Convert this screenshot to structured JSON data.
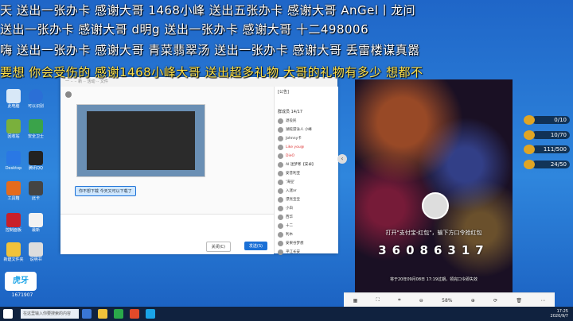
{
  "danmaku": {
    "line1": "天  送出一张办卡    感谢大哥   1468小峰  送出五张办卡      感谢大哥    AnGel丨龙问",
    "line2": "  送出一张办卡    感谢大哥    d明g        送出一张办卡      感谢大哥    十二498006",
    "line3": "嗨  送出一张办卡  感谢大哥   青菜翡翠汤 送出一张办卡    感谢大哥    丢雷楼谋真嚣",
    "line4": "要想 你会受伤的          感谢1468小峰大哥 送出超多礼物  大哥的礼物有多少 想都不"
  },
  "desktop_icons": [
    "此电脑",
    "可以识别",
    "回收站",
    "安全卫士",
    "Desktop",
    "腾讯QQ",
    "工具箱",
    "此卡",
    "控制面板",
    "最新",
    "新建文件夹",
    "说明书"
  ],
  "chat": {
    "header": "一 ·· ·· 新 ·· 活动 ·· 文件",
    "bubble": "你不想下载 今天又可以下载了",
    "send_label": "发送(S)",
    "close_label": "关闭(C)",
    "announce": "[公告]",
    "members_title": "群成员 14/17",
    "members": [
      "退役民",
      "湖蛇游泳人 小峰",
      "Johnny卡",
      "Like you@",
      "DieO",
      "AI 迷梦寒【安卓】",
      "安普利亚",
      "'海豆'",
      "入迷ar",
      "漂亮宝宝",
      "小白",
      "西华",
      "十二",
      "利木",
      "安果谷梦想",
      "平江长安"
    ]
  },
  "phone": {
    "hongbao_text": "打开\"支付宝-红包\"，输下方口令抢红包",
    "code": "36086317",
    "footer": "将于20年09月08日 17:19过期，领完口令即失效"
  },
  "gifts": [
    "0/10",
    "10/70",
    "111/500",
    "24/50"
  ],
  "toolbar": {
    "zoom": "58%"
  },
  "taskbar": {
    "search_placeholder": "在这里输入你要搜索的内容",
    "time": "17:25",
    "date": "2020/9/7"
  },
  "logo": {
    "number": "1671907",
    "name": "虎牙"
  },
  "colors": {
    "taskbar": "#10223f",
    "desktop": "#2f86dd",
    "accent": "#1b70d6"
  }
}
